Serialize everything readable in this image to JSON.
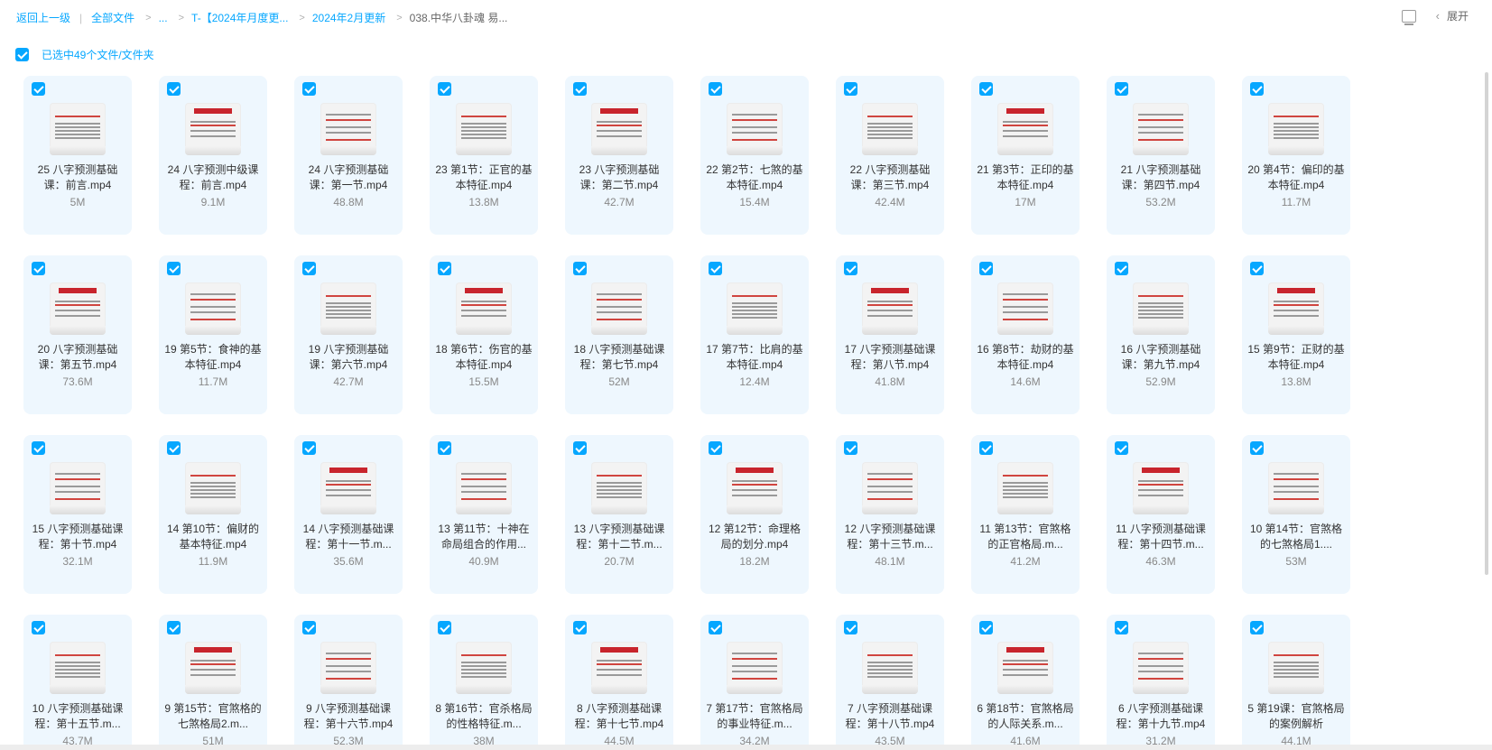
{
  "breadcrumb": {
    "back": "返回上一级",
    "root": "全部文件",
    "ellipsis": "...",
    "level1": "T-【2024年月度更...",
    "level2": "2024年2月更新",
    "current": "038.中华八卦魂 易..."
  },
  "toolbar": {
    "expand_label": "展开"
  },
  "selection": {
    "text": "已选中49个文件/文件夹"
  },
  "files": [
    {
      "name": "25 八字预测基础课：前言.mp4",
      "size": "5M"
    },
    {
      "name": "24 八字预测中级课程：前言.mp4",
      "size": "9.1M"
    },
    {
      "name": "24 八字预测基础课：第一节.mp4",
      "size": "48.8M"
    },
    {
      "name": "23 第1节：正官的基本特征.mp4",
      "size": "13.8M"
    },
    {
      "name": "23 八字预测基础课：第二节.mp4",
      "size": "42.7M"
    },
    {
      "name": "22 第2节：七煞的基本特征.mp4",
      "size": "15.4M"
    },
    {
      "name": "22 八字预测基础课：第三节.mp4",
      "size": "42.4M"
    },
    {
      "name": "21 第3节：正印的基本特征.mp4",
      "size": "17M"
    },
    {
      "name": "21 八字预测基础课：第四节.mp4",
      "size": "53.2M"
    },
    {
      "name": "20 第4节：偏印的基本特征.mp4",
      "size": "11.7M"
    },
    {
      "name": "20 八字预测基础课：第五节.mp4",
      "size": "73.6M"
    },
    {
      "name": "19 第5节：食神的基本特征.mp4",
      "size": "11.7M"
    },
    {
      "name": "19 八字预测基础课：第六节.mp4",
      "size": "42.7M"
    },
    {
      "name": "18 第6节：伤官的基本特征.mp4",
      "size": "15.5M"
    },
    {
      "name": "18 八字预测基础课程：第七节.mp4",
      "size": "52M"
    },
    {
      "name": "17 第7节：比肩的基本特征.mp4",
      "size": "12.4M"
    },
    {
      "name": "17 八字预测基础课程：第八节.mp4",
      "size": "41.8M"
    },
    {
      "name": "16 第8节：劫财的基本特征.mp4",
      "size": "14.6M"
    },
    {
      "name": "16 八字预测基础课：第九节.mp4",
      "size": "52.9M"
    },
    {
      "name": "15 第9节：正财的基本特征.mp4",
      "size": "13.8M"
    },
    {
      "name": "15 八字预测基础课程：第十节.mp4",
      "size": "32.1M"
    },
    {
      "name": "14 第10节：偏财的基本特征.mp4",
      "size": "11.9M"
    },
    {
      "name": "14 八字预测基础课程：第十一节.m...",
      "size": "35.6M"
    },
    {
      "name": "13 第11节：十神在命局组合的作用...",
      "size": "40.9M"
    },
    {
      "name": "13 八字预测基础课程：第十二节.m...",
      "size": "20.7M"
    },
    {
      "name": "12 第12节：命理格局的划分.mp4",
      "size": "18.2M"
    },
    {
      "name": "12 八字预测基础课程：第十三节.m...",
      "size": "48.1M"
    },
    {
      "name": "11 第13节：官煞格的正官格局.m...",
      "size": "41.2M"
    },
    {
      "name": "11 八字预测基础课程：第十四节.m...",
      "size": "46.3M"
    },
    {
      "name": "10 第14节：官煞格的七煞格局1....",
      "size": "53M"
    },
    {
      "name": "10 八字预测基础课程：第十五节.m...",
      "size": "43.7M"
    },
    {
      "name": "9 第15节：官煞格的七煞格局2.m...",
      "size": "51M"
    },
    {
      "name": "9 八字预测基础课程：第十六节.mp4",
      "size": "52.3M"
    },
    {
      "name": "8 第16节：官杀格局的性格特征.m...",
      "size": "38M"
    },
    {
      "name": "8 八字预测基础课程：第十七节.mp4",
      "size": "44.5M"
    },
    {
      "name": "7 第17节：官煞格局的事业特征.m...",
      "size": "34.2M"
    },
    {
      "name": "7 八字预测基础课程：第十八节.mp4",
      "size": "43.5M"
    },
    {
      "name": "6 第18节：官煞格局的人际关系.m...",
      "size": "41.6M"
    },
    {
      "name": "6 八字预测基础课程：第十九节.mp4",
      "size": "31.2M"
    },
    {
      "name": "5 第19课：官煞格局的案例解析",
      "size": "44.1M"
    }
  ],
  "colors": {
    "accent": "#06a7ff",
    "card_bg": "#eef7fe",
    "thumb_red": "#c8242c"
  }
}
